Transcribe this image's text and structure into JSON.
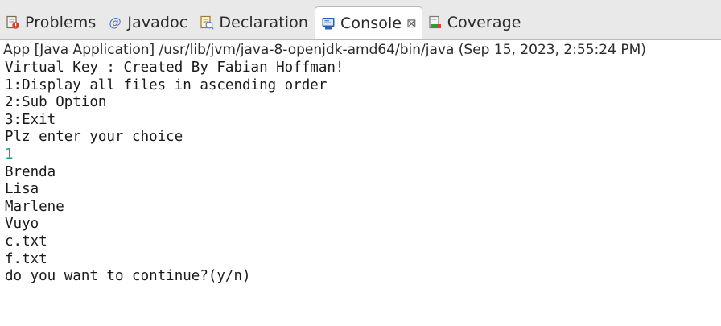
{
  "tabs": [
    {
      "label": "Problems",
      "icon": "problems-icon",
      "active": false
    },
    {
      "label": "Javadoc",
      "icon": "javadoc-icon",
      "active": false
    },
    {
      "label": "Declaration",
      "icon": "declaration-icon",
      "active": false
    },
    {
      "label": "Console",
      "icon": "console-icon",
      "active": true,
      "close": "⊠"
    },
    {
      "label": "Coverage",
      "icon": "coverage-icon",
      "active": false
    }
  ],
  "launch": {
    "text": "App [Java Application] /usr/lib/jvm/java-8-openjdk-amd64/bin/java (Sep 15, 2023, 2:55:24 PM)"
  },
  "console": {
    "lines": [
      {
        "text": "Virtual Key : Created By Fabian Hoffman!"
      },
      {
        "text": "1:Display all files in ascending order"
      },
      {
        "text": "2:Sub Option"
      },
      {
        "text": "3:Exit"
      },
      {
        "text": "Plz enter your choice"
      },
      {
        "text": "1",
        "input": true
      },
      {
        "text": "Brenda"
      },
      {
        "text": "Lisa"
      },
      {
        "text": "Marlene"
      },
      {
        "text": "Vuyo"
      },
      {
        "text": "c.txt"
      },
      {
        "text": "f.txt"
      },
      {
        "text": "do you want to continue?(y/n)"
      }
    ]
  },
  "colors": {
    "user_input": "#19a28a",
    "tab_bar": "#e9e9e9",
    "console_icon": "#2f5fb3"
  }
}
